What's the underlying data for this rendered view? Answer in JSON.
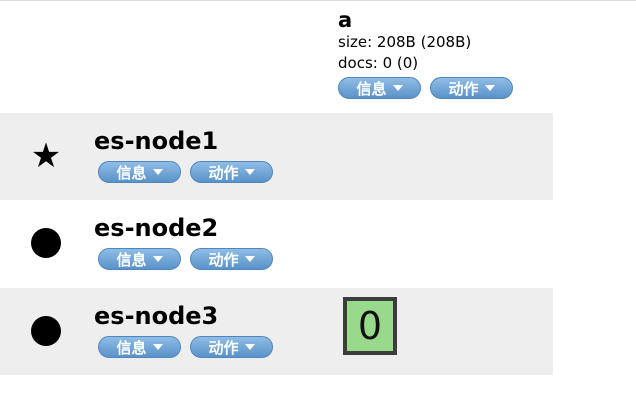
{
  "index": {
    "name": "a",
    "size": "size: 208B (208B)",
    "docs": "docs: 0 (0)",
    "info_label": "信息",
    "action_label": "动作"
  },
  "nodes": [
    {
      "name": "es-node1",
      "marker": "★",
      "info_label": "信息",
      "action_label": "动作"
    },
    {
      "name": "es-node2",
      "marker": "dot",
      "info_label": "信息",
      "action_label": "动作"
    },
    {
      "name": "es-node3",
      "marker": "dot",
      "info_label": "信息",
      "action_label": "动作"
    }
  ],
  "shard": {
    "label": "0",
    "color": "#99d98c",
    "border_color": "#3c3c3c"
  },
  "colors": {
    "button": "#5a92c8",
    "row_shade": "#eeeeee"
  }
}
